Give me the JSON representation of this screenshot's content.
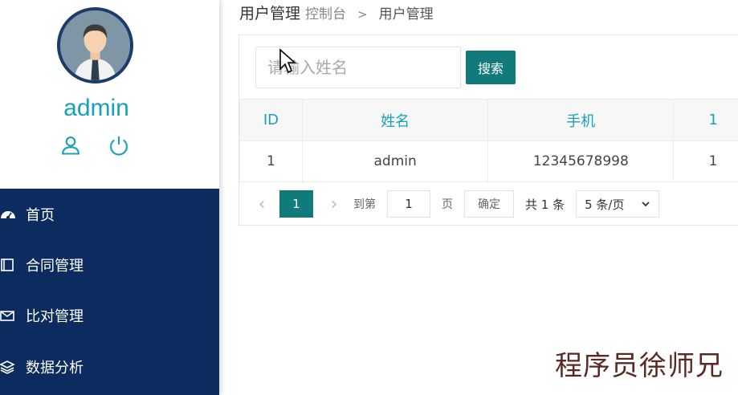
{
  "sidebar": {
    "username": "admin",
    "user_icons": [
      "user-icon",
      "power-icon"
    ],
    "menu": [
      {
        "label": "首页",
        "icon": "dashboard-icon"
      },
      {
        "label": "合同管理",
        "icon": "book-icon"
      },
      {
        "label": "比对管理",
        "icon": "mail-icon"
      },
      {
        "label": "数据分析",
        "icon": "layers-icon"
      }
    ]
  },
  "breadcrumb": {
    "title": "用户管理",
    "link": "控制台",
    "separator": ">",
    "current": "用户管理"
  },
  "search": {
    "placeholder": "请输入姓名",
    "button": "搜索"
  },
  "table": {
    "headers": [
      "ID",
      "姓名",
      "手机",
      "1"
    ],
    "rows": [
      [
        "1",
        "admin",
        "12345678998",
        "1"
      ]
    ]
  },
  "pager": {
    "prev": "‹",
    "current_page": "1",
    "next": "›",
    "goto_label": "到第",
    "goto_value": "1",
    "page_unit": "页",
    "confirm": "确定",
    "total": "共 1 条",
    "page_size": "5 条/页"
  },
  "watermark": "程序员徐师兄",
  "colors": {
    "accent": "#117a7a",
    "sidebar_menu": "#0c2b5e",
    "username": "#17a2b8",
    "watermark": "#5a2a22"
  }
}
